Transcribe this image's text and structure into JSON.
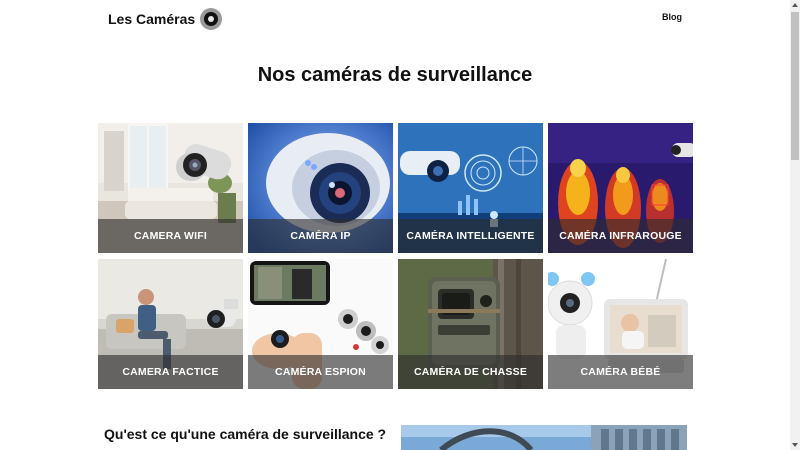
{
  "header": {
    "logo_text": "Les Caméras",
    "nav": {
      "blog_label": "Blog"
    }
  },
  "page_title": "Nos caméras de surveillance",
  "cards": [
    {
      "label": "CAMERA WIFI",
      "icon": "camera-wifi-image"
    },
    {
      "label": "CAMÉRA IP",
      "icon": "camera-ip-image"
    },
    {
      "label": "CAMÉRA INTELLIGENTE",
      "icon": "camera-intelligente-image"
    },
    {
      "label": "CAMÉRA INFRAROUGE",
      "icon": "camera-infrarouge-image"
    },
    {
      "label": "CAMERA FACTICE",
      "icon": "camera-factice-image"
    },
    {
      "label": "CAMÉRA ESPION",
      "icon": "camera-espion-image"
    },
    {
      "label": "CAMÉRA DE CHASSE",
      "icon": "camera-chasse-image"
    },
    {
      "label": "CAMÉRA BÉBÉ",
      "icon": "camera-bebe-image"
    }
  ],
  "section": {
    "title": "Qu'est ce qu'une caméra de surveillance ?"
  },
  "colors": {
    "caption_overlay": "#2d2d2d",
    "text": "#111111",
    "background": "#ffffff"
  }
}
